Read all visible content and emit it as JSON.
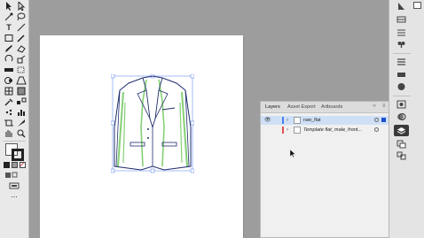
{
  "layers_panel": {
    "tabs": [
      {
        "label": "Layers",
        "active": true
      },
      {
        "label": "Asset Export",
        "active": false
      },
      {
        "label": "Artboards",
        "active": false
      }
    ],
    "layers": [
      {
        "name": "raw_flat",
        "color": "#4a7ff0",
        "selected": true,
        "visible": true
      },
      {
        "name": "Template flat_male_front...",
        "color": "#e05050",
        "selected": false,
        "visible": false
      }
    ]
  },
  "toolbar": {
    "tools": [
      "selection-tool",
      "direct-selection-tool",
      "magic-wand-tool",
      "lasso-tool",
      "pen-tool",
      "curvature-tool",
      "type-tool",
      "line-tool",
      "rectangle-tool",
      "paintbrush-tool",
      "pencil-tool",
      "eraser-tool",
      "rotate-tool",
      "scale-tool",
      "width-tool",
      "free-transform-tool",
      "shape-builder-tool",
      "perspective-tool",
      "mesh-tool",
      "gradient-tool",
      "eyedropper-tool",
      "blend-tool",
      "symbol-sprayer-tool",
      "column-graph-tool",
      "artboard-tool",
      "slice-tool",
      "hand-tool",
      "zoom-tool"
    ],
    "fill_color": "#ffffff",
    "stroke_color": "#000000",
    "more_label": "..."
  },
  "artwork": {
    "description_colors": {
      "outline": "#1f2d6e",
      "accent": "#7ccf6b"
    }
  },
  "accent_colors": {
    "selection": "#4a7ff0",
    "panel_select": "#cfe0f6"
  }
}
